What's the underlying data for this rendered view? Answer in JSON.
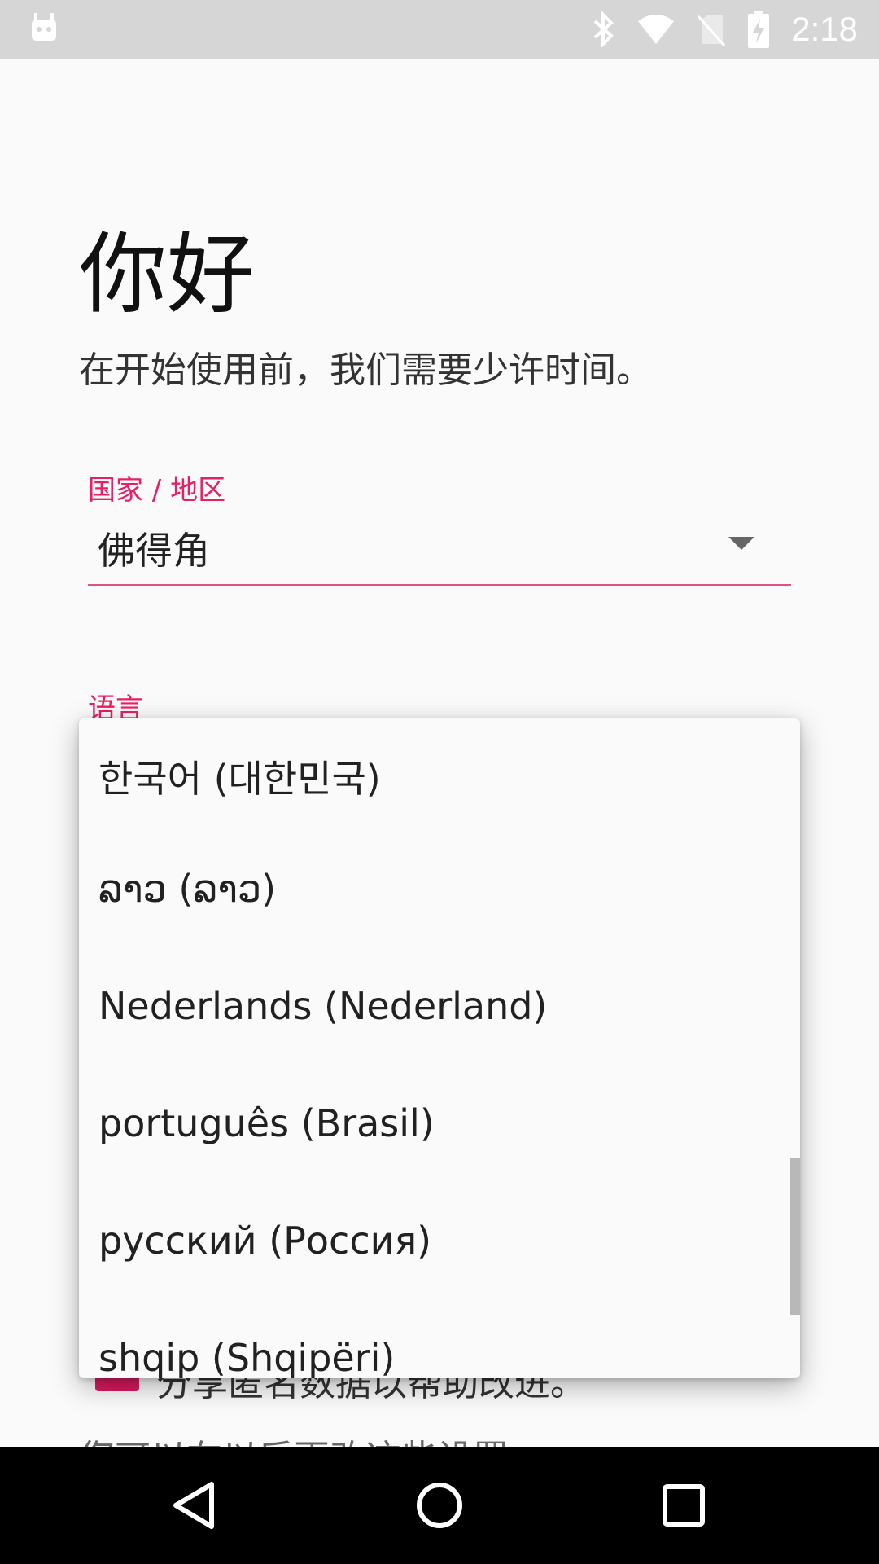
{
  "status_bar": {
    "time": "2:18",
    "icons": [
      "android-icon",
      "bluetooth-icon",
      "wifi-icon",
      "no-sim-icon",
      "battery-charging-icon"
    ]
  },
  "header": {
    "greeting": "你好",
    "subtitle": "在开始使用前，我们需要少许时间。"
  },
  "country_field": {
    "label": "国家 / 地区",
    "value": "佛得角"
  },
  "language_field": {
    "label": "语言"
  },
  "language_dropdown": {
    "items": [
      {
        "label": "한국어 (대한민국)"
      },
      {
        "label": "ລາວ (ລາວ)"
      },
      {
        "label": "Nederlands (Nederland)"
      },
      {
        "label": "português (Brasil)"
      },
      {
        "label": "русский (Россия)"
      },
      {
        "label": "shqip (Shqipëri)"
      }
    ]
  },
  "behind_popup": {
    "checkbox_text": "分享匿名数据以帮助改进。",
    "footer_note": "您可以在以后更改这些设置。"
  },
  "nav_bar": {
    "icons": [
      "back-icon",
      "home-icon",
      "recents-icon"
    ]
  },
  "colors": {
    "accent": "#e91e63",
    "status_bar": "#d6d6d6",
    "nav_bar": "#000000"
  }
}
